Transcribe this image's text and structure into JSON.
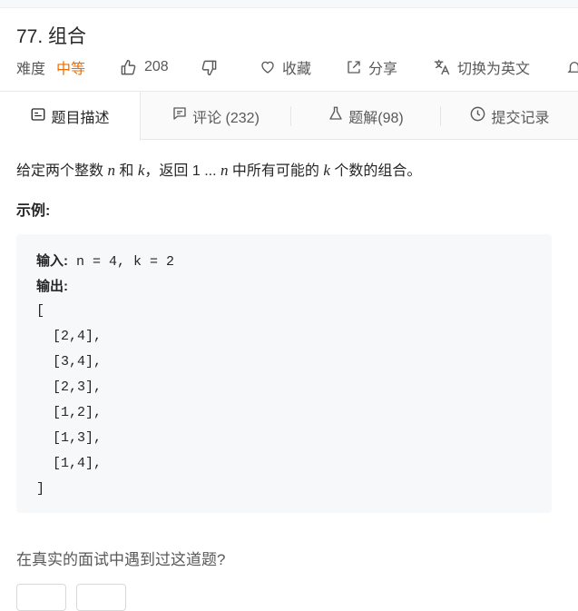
{
  "problem": {
    "title": "77. 组合",
    "difficulty_label": "难度",
    "difficulty_value": "中等",
    "likes": "208",
    "favorite_label": "收藏",
    "share_label": "分享",
    "switch_lang_label": "切换为英文"
  },
  "colors": {
    "difficulty": "#ef6c00",
    "code_bg": "#f7f8fa",
    "tab_bg": "#fafafa"
  },
  "tabs": [
    {
      "label": "题目描述",
      "icon": "description-icon",
      "active": true
    },
    {
      "label": "评论 (232)",
      "icon": "comment-icon"
    },
    {
      "label": "题解(98)",
      "icon": "flask-icon"
    },
    {
      "label": "提交记录",
      "icon": "clock-icon"
    }
  ],
  "content": {
    "desc_prefix": "给定两个整数 ",
    "var_n": "n",
    "desc_and": " 和 ",
    "var_k": "k",
    "desc_mid": "，返回 1 ... ",
    "desc_mid2": " 中所有可能的 ",
    "desc_suffix": " 个数的组合。",
    "example_label": "示例:",
    "input_label": "输入:",
    "input_value": " n = 4, k = 2",
    "output_label": "输出:",
    "output_lines": [
      "[",
      "  [2,4],",
      "  [3,4],",
      "  [2,3],",
      "  [1,2],",
      "  [1,3],",
      "  [1,4],",
      "]"
    ],
    "question": "在真实的面试中遇到过这道题?"
  }
}
